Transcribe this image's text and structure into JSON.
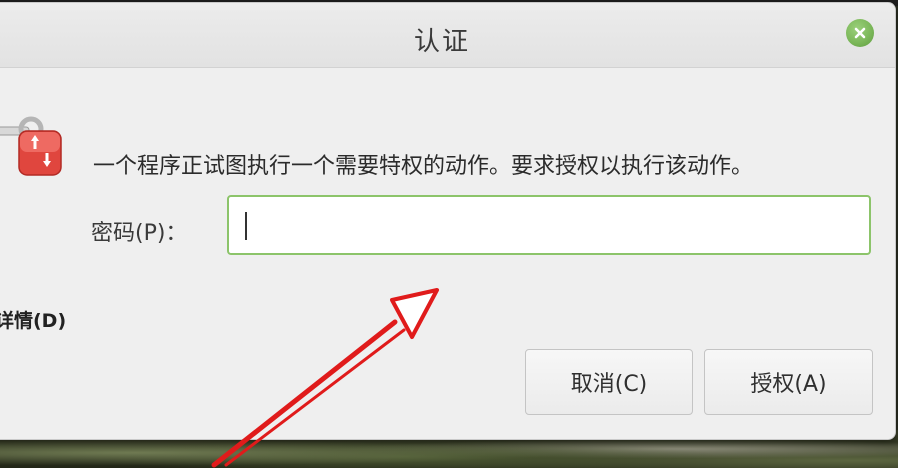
{
  "window": {
    "title": "认证",
    "close_icon": "close-icon"
  },
  "dialog": {
    "icon": "key-lock-icon",
    "message": "一个程序正试图执行一个需要特权的动作。要求授权以执行该动作。",
    "password_label": "密码(P)：",
    "password_value": "",
    "details_label": "详情(D)",
    "cancel_label": "取消(C)",
    "authorize_label": "授权(A)"
  },
  "colors": {
    "close_button": "#7cb85a",
    "input_focus_border": "#8cc46a",
    "annotation_arrow": "#e01b1b"
  }
}
